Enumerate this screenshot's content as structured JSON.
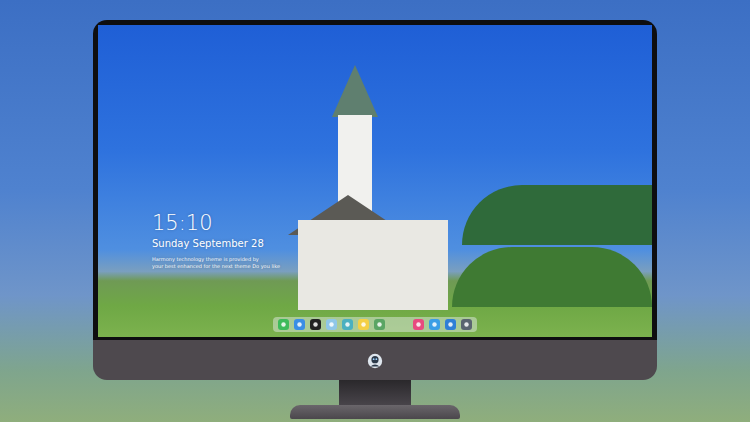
{
  "desktop": {
    "clock": "15:10",
    "date": "Sunday September 28",
    "notice": [
      "Harmony technology theme is provided by",
      "your best enhanced for the next theme Do you like"
    ]
  },
  "dock": {
    "items": [
      {
        "color": "#3dbb5a",
        "kind": "app"
      },
      {
        "color": "#3a8ee6",
        "kind": "app"
      },
      {
        "color": "#222222",
        "kind": "app"
      },
      {
        "color": "#8fc7e8",
        "kind": "app"
      },
      {
        "color": "#4bb0c0",
        "kind": "app"
      },
      {
        "color": "#f4d046",
        "kind": "app"
      },
      {
        "color": "#5aa564",
        "kind": "app"
      },
      {
        "color": "#e84a7f",
        "kind": "app"
      },
      {
        "color": "#3a9ee6",
        "kind": "app"
      },
      {
        "color": "#2f7fd6",
        "kind": "app"
      },
      {
        "color": "#5a6470",
        "kind": "app"
      }
    ]
  }
}
